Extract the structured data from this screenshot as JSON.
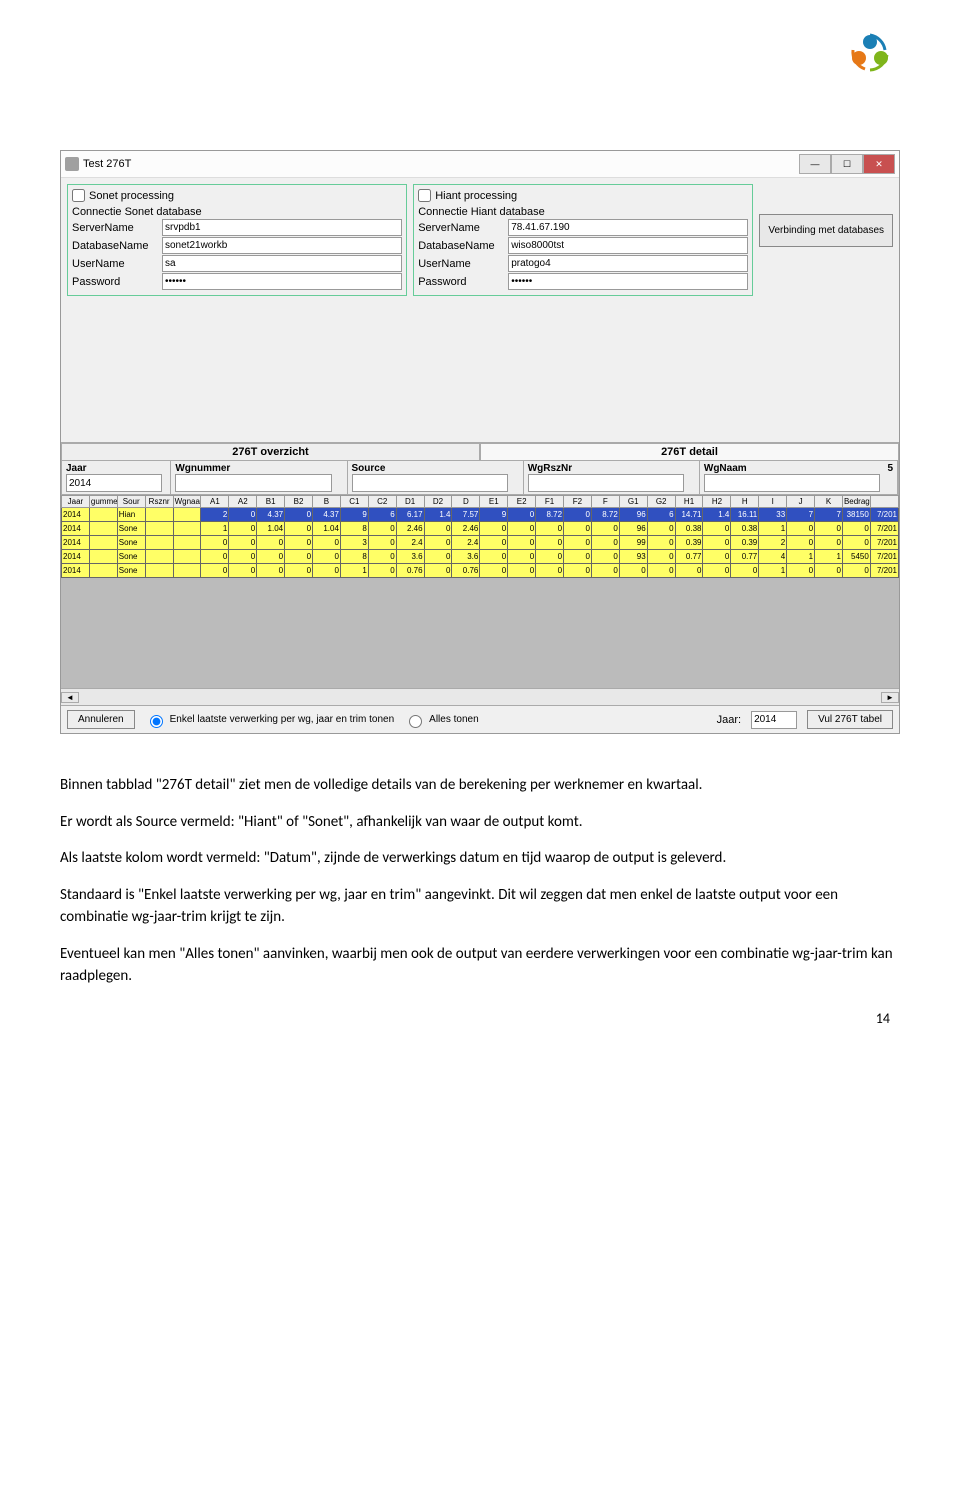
{
  "window": {
    "title": "Test 276T",
    "sonet": {
      "processing": "Sonet processing",
      "group": "Connectie Sonet database",
      "server_lbl": "ServerName",
      "server": "srvpdb1",
      "db_lbl": "DatabaseName",
      "db": "sonet21workb",
      "user_lbl": "UserName",
      "user": "sa",
      "pass_lbl": "Password",
      "pass": "••••••"
    },
    "hiant": {
      "processing": "Hiant processing",
      "group": "Connectie Hiant database",
      "server_lbl": "ServerName",
      "server": "78.41.67.190",
      "db_lbl": "DatabaseName",
      "db": "wiso8000tst",
      "user_lbl": "UserName",
      "user": "pratogo4",
      "pass_lbl": "Password",
      "pass": "••••••"
    },
    "verbinding": "Verbinding met databases",
    "tabs": {
      "overzicht": "276T overzicht",
      "detail": "276T detail"
    },
    "filter": {
      "jaar_lbl": "Jaar",
      "jaar": "2014",
      "wgnummer_lbl": "Wgnummer",
      "source_lbl": "Source",
      "wgrsznr_lbl": "WgRszNr",
      "wgnaam_lbl": "WgNaam",
      "count": "5"
    },
    "headers": [
      "Jaar",
      "gummer",
      "Sour",
      "Rsznr",
      "Wgnaam",
      "A1",
      "A2",
      "B1",
      "B2",
      "B",
      "C1",
      "C2",
      "D1",
      "D2",
      "D",
      "E1",
      "E2",
      "F1",
      "F2",
      "F",
      "G1",
      "G2",
      "H1",
      "H2",
      "H",
      "I",
      "J",
      "K",
      "Bedrag",
      ""
    ],
    "rows": [
      {
        "hi": true,
        "cells": [
          "2014",
          "",
          "Hian",
          "",
          "",
          "2",
          "0",
          "4.37",
          "0",
          "4.37",
          "9",
          "6",
          "6.17",
          "1.4",
          "7.57",
          "9",
          "0",
          "8.72",
          "0",
          "8.72",
          "96",
          "6",
          "14.71",
          "1.4",
          "16.11",
          "33",
          "7",
          "7",
          "38150",
          "7/201"
        ]
      },
      {
        "cells": [
          "2014",
          "",
          "Sone",
          "",
          "",
          "1",
          "0",
          "1.04",
          "0",
          "1.04",
          "8",
          "0",
          "2.46",
          "0",
          "2.46",
          "0",
          "0",
          "0",
          "0",
          "0",
          "96",
          "0",
          "0.38",
          "0",
          "0.38",
          "1",
          "0",
          "0",
          "0",
          "7/201"
        ]
      },
      {
        "cells": [
          "2014",
          "",
          "Sone",
          "",
          "",
          "0",
          "0",
          "0",
          "0",
          "0",
          "3",
          "0",
          "2.4",
          "0",
          "2.4",
          "0",
          "0",
          "0",
          "0",
          "0",
          "99",
          "0",
          "0.39",
          "0",
          "0.39",
          "2",
          "0",
          "0",
          "0",
          "7/201"
        ]
      },
      {
        "cells": [
          "2014",
          "",
          "Sone",
          "",
          "",
          "0",
          "0",
          "0",
          "0",
          "0",
          "8",
          "0",
          "3.6",
          "0",
          "3.6",
          "0",
          "0",
          "0",
          "0",
          "0",
          "93",
          "0",
          "0.77",
          "0",
          "0.77",
          "4",
          "1",
          "1",
          "5450",
          "7/201"
        ]
      },
      {
        "cells": [
          "2014",
          "",
          "Sone",
          "",
          "",
          "0",
          "0",
          "0",
          "0",
          "0",
          "1",
          "0",
          "0.76",
          "0",
          "0.76",
          "0",
          "0",
          "0",
          "0",
          "0",
          "0",
          "0",
          "0",
          "0",
          "0",
          "1",
          "0",
          "0",
          "0",
          "7/201"
        ]
      }
    ],
    "footer": {
      "annuleren": "Annuleren",
      "enkel": "Enkel laatste verwerking per wg, jaar en trim tonen",
      "alles": "Alles tonen",
      "jaar_lbl": "Jaar:",
      "jaar": "2014",
      "vul": "Vul 276T tabel"
    }
  },
  "explain": {
    "p1": "Binnen tabblad \"276T detail\" ziet men de volledige details van de berekening per werknemer en kwartaal.",
    "p2": "Er wordt als Source vermeld: \"Hiant\" of \"Sonet\", afhankelijk van waar de output komt.",
    "p3": "Als laatste kolom wordt vermeld: \"Datum\", zijnde de verwerkings datum en tijd waarop de output is geleverd.",
    "p4": "Standaard is \"Enkel laatste verwerking per wg, jaar en trim\" aangevinkt. Dit wil zeggen dat men enkel de laatste output voor een combinatie wg-jaar-trim krijgt te zijn.",
    "p5": "Eventueel kan men \"Alles tonen\" aanvinken, waarbij men ook de output van eerdere verwerkingen voor een combinatie wg-jaar-trim kan raadplegen."
  },
  "page_num": "14"
}
